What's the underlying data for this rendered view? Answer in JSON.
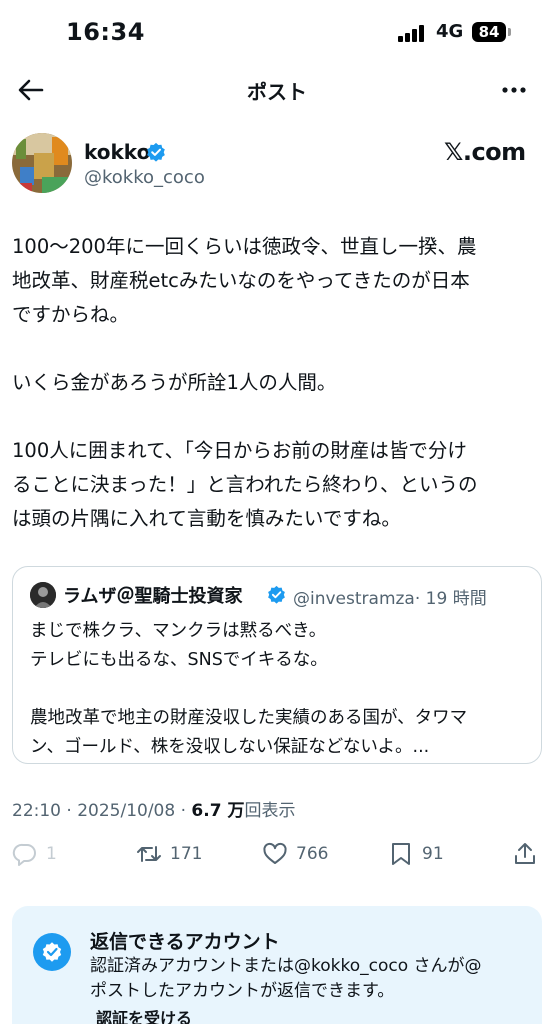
{
  "status_bar": {
    "time": "16:34",
    "network": "4G",
    "battery": "84"
  },
  "nav": {
    "title": "ポスト"
  },
  "author": {
    "name": "kokko",
    "handle": "@kokko_coco",
    "site": "𝕏.com"
  },
  "post": {
    "paragraph1": [
      "100〜200年に一回くらいは徳政令、世直し一揆、農",
      "地改革、財産税etcみたいなのをやってきたのが日本",
      "ですからね。"
    ],
    "paragraph2": "いくら金があろうが所詮1人の人間。",
    "paragraph3": [
      "100人に囲まれて、「今日からお前の財産は皆で分け",
      "ることに決まった！」と言われたら終わり、というの",
      "は頭の片隅に入れて言動を慎みたいですね。"
    ]
  },
  "quote": {
    "name": "ラムザ＠聖騎士投資家",
    "handle": "@investramza",
    "time": "· 19 時間",
    "line1": "まじで株クラ、マンクラは黙るべき。",
    "line2": "テレビにも出るな、SNSでイキるな。",
    "line3": "農地改革で地主の財産没収した実績のある国が、タワマ",
    "line4": "ン、ゴールド、株を没収しない保証などないよ。..."
  },
  "meta": {
    "time": "22:10 · 2025/10/08 · ",
    "views": "6.7 万",
    "views_label": "回表示"
  },
  "actions": {
    "replies": "1",
    "retweets": "171",
    "likes": "766",
    "bookmarks": "91"
  },
  "reply_notice": {
    "title": "返信できるアカウント",
    "line1": "認証済みアカウントまたは@kokko_coco さんが@",
    "line2": "ポストしたアカウントが返信できます。",
    "link": "認証を受ける"
  },
  "colors": {
    "accent": "#1d9bf0",
    "secondary_text": "#536471",
    "reply_box_bg": "#e8f5fd"
  },
  "icons": [
    "back-arrow-icon",
    "more-icon",
    "verified-badge-icon",
    "reply-icon",
    "retweet-icon",
    "like-icon",
    "bookmark-icon",
    "share-icon"
  ]
}
